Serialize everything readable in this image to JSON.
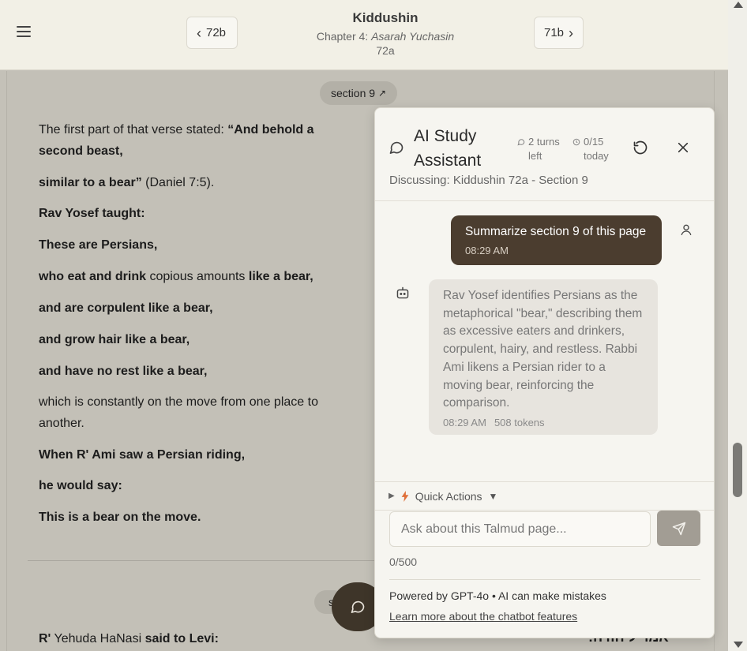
{
  "header": {
    "title": "Kiddushin",
    "chapter_prefix": "Chapter 4: ",
    "chapter_name": "Asarah Yuchasin",
    "page": "72a",
    "prev_label": "72b",
    "next_label": "71b"
  },
  "section": {
    "label": "section 9",
    "arrow": "↗",
    "next_label": "s"
  },
  "text_lines": [
    {
      "plain_before": "The first part of that verse stated: ",
      "bold": "“And behold a second beast,",
      "plain_after": ""
    },
    {
      "plain_before": "",
      "bold": "similar to a bear”",
      "plain_after": " (Daniel 7:5)."
    },
    {
      "plain_before": "",
      "bold": "Rav Yosef taught:",
      "plain_after": ""
    },
    {
      "plain_before": "",
      "bold": "These are Persians,",
      "plain_after": ""
    },
    {
      "plain_before": "",
      "bold": "who eat and drink",
      "plain_after": " copious amounts ",
      "bold2": "like a bear,"
    },
    {
      "plain_before": "",
      "bold": "and are corpulent like a bear,",
      "plain_after": ""
    },
    {
      "plain_before": "",
      "bold": "and grow hair like a bear,",
      "plain_after": ""
    },
    {
      "plain_before": "",
      "bold": "and have no rest like a bear,",
      "plain_after": ""
    },
    {
      "plain_before": "which is constantly on the move from one place to another.",
      "bold": "",
      "plain_after": ""
    },
    {
      "plain_before": "",
      "bold": "When R' Ami saw a Persian riding,",
      "plain_after": ""
    },
    {
      "plain_before": "",
      "bold": "he would say:",
      "plain_after": ""
    },
    {
      "plain_before": "",
      "bold": "This is a bear on the move.",
      "plain_after": ""
    }
  ],
  "next_section": {
    "line_bold1": "R'",
    "line_plain": " Yehuda HaNasi ",
    "line_bold2": "said to Levi:",
    "hebrew": "אמר ליהודה:"
  },
  "chat": {
    "title": "AI Study Assistant",
    "turns_left": "2 turns left",
    "today": "0/15 today",
    "subtitle": "Discussing: Kiddushin 72a - Section 9",
    "messages": {
      "user_text": "Summarize section 9 of this page",
      "user_time": "08:29 AM",
      "bot_text": "Rav Yosef identifies Persians as the metaphorical \"bear,\" describing them as excessive eaters and drinkers, corpulent, hairy, and restless. Rabbi Ami likens a Persian rider to a moving bear, reinforcing the comparison.",
      "bot_time": "08:29 AM",
      "bot_tokens": "508 tokens"
    },
    "quick_actions_label": "Quick Actions",
    "input_placeholder": "Ask about this Talmud page...",
    "counter": "0/500",
    "powered_by": "Powered by GPT-4o • AI can make mistakes",
    "learn_more": "Learn more about the chatbot features"
  },
  "colors": {
    "header_bg": "#f2f0e6",
    "page_bg": "#c3c0b7",
    "user_bubble": "#4b3d2f",
    "bot_bubble": "#e7e4de",
    "fab": "#3e3529",
    "send_button": "#a29d94",
    "quick_action_accent": "#e0703a"
  }
}
